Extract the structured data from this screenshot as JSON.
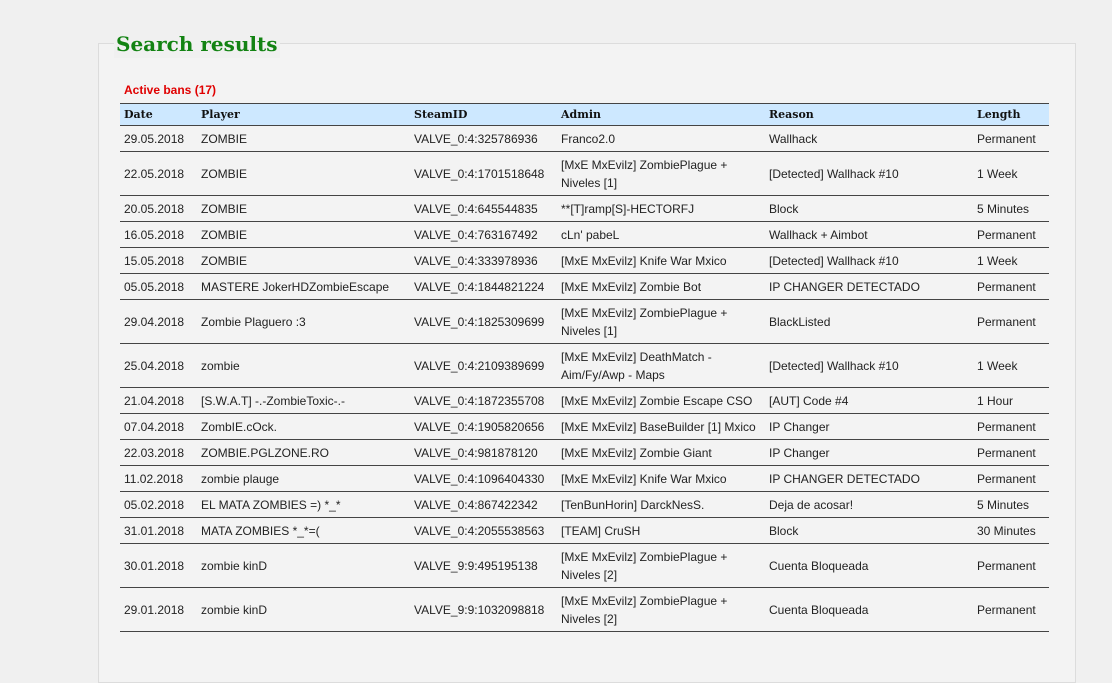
{
  "header": {
    "title": "Search results",
    "subtitle": "Active bans (17)"
  },
  "table": {
    "columns": [
      "Date",
      "Player",
      "SteamID",
      "Admin",
      "Reason",
      "Length"
    ],
    "rows": [
      [
        "29.05.2018",
        "ZOMBIE",
        "VALVE_0:4:325786936",
        "Franco2.0",
        "Wallhack",
        "Permanent"
      ],
      [
        "22.05.2018",
        "ZOMBIE",
        "VALVE_0:4:1701518648",
        "[MxE MxEvilz] ZombiePlague + Niveles [1]",
        "[Detected] Wallhack #10",
        "1 Week"
      ],
      [
        "20.05.2018",
        "ZOMBIE",
        "VALVE_0:4:645544835",
        "**[T]ramp[S]-HECTORFJ",
        "Block",
        "5 Minutes"
      ],
      [
        "16.05.2018",
        "ZOMBIE",
        "VALVE_0:4:763167492",
        "cLn' pabeL",
        "Wallhack + Aimbot",
        "Permanent"
      ],
      [
        "15.05.2018",
        "ZOMBIE",
        "VALVE_0:4:333978936",
        "[MxE MxEvilz] Knife War Mxico",
        "[Detected] Wallhack #10",
        "1 Week"
      ],
      [
        "05.05.2018",
        "MASTERE JokerHDZombieEscape",
        "VALVE_0:4:1844821224",
        "[MxE MxEvilz] Zombie Bot",
        "IP CHANGER DETECTADO",
        "Permanent"
      ],
      [
        "29.04.2018",
        "Zombie Plaguero :3",
        "VALVE_0:4:1825309699",
        "[MxE MxEvilz] ZombiePlague + Niveles [1]",
        "BlackListed",
        "Permanent"
      ],
      [
        "25.04.2018",
        "zombie",
        "VALVE_0:4:2109389699",
        "[MxE MxEvilz] DeathMatch - Aim/Fy/Awp - Maps",
        "[Detected] Wallhack #10",
        "1 Week"
      ],
      [
        "21.04.2018",
        "[S.W.A.T] -.-ZombieToxic-.-",
        "VALVE_0:4:1872355708",
        "[MxE MxEvilz] Zombie Escape CSO",
        "[AUT] Code #4",
        "1 Hour"
      ],
      [
        "07.04.2018",
        "ZombIE.cOck.",
        "VALVE_0:4:1905820656",
        "[MxE MxEvilz] BaseBuilder [1] Mxico",
        "IP Changer",
        "Permanent"
      ],
      [
        "22.03.2018",
        "ZOMBIE.PGLZONE.RO",
        "VALVE_0:4:981878120",
        "[MxE MxEvilz] Zombie Giant",
        "IP Changer",
        "Permanent"
      ],
      [
        "11.02.2018",
        "zombie plauge",
        "VALVE_0:4:1096404330",
        "[MxE MxEvilz] Knife War Mxico",
        "IP CHANGER DETECTADO",
        "Permanent"
      ],
      [
        "05.02.2018",
        "EL MATA ZOMBIES =) *_*",
        "VALVE_0:4:867422342",
        "[TenBunHorin] DarckNesS.",
        "Deja de acosar!",
        "5 Minutes"
      ],
      [
        "31.01.2018",
        "MATA ZOMBIES *_*=(",
        "VALVE_0:4:2055538563",
        "[TEAM] CruSH",
        "Block",
        "30 Minutes"
      ],
      [
        "30.01.2018",
        "zombie kinD",
        "VALVE_9:9:495195138",
        "[MxE MxEvilz] ZombiePlague + Niveles [2]",
        "Cuenta Bloqueada",
        "Permanent"
      ],
      [
        "29.01.2018",
        "zombie kinD",
        "VALVE_9:9:1032098818",
        "[MxE MxEvilz] ZombiePlague + Niveles [2]",
        "Cuenta Bloqueada",
        "Permanent"
      ]
    ]
  },
  "colors": {
    "title": "#138313",
    "subtitle": "#e00000",
    "header_bg": "#cde8ff"
  }
}
